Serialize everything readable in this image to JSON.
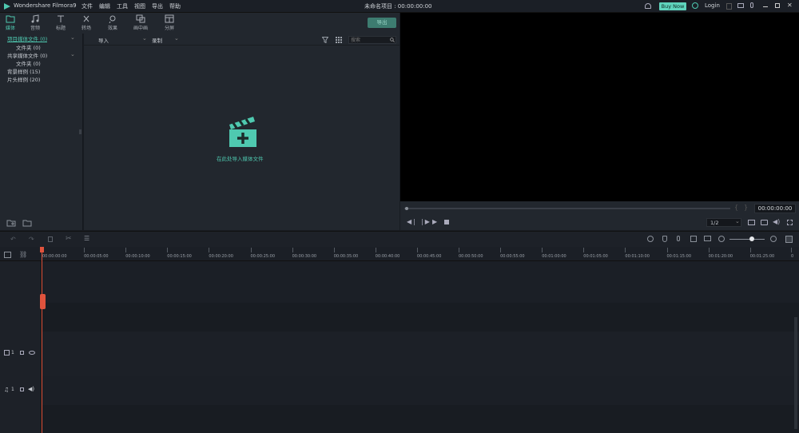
{
  "app": {
    "name": "Wondershare Filmora9"
  },
  "menu": [
    "文件",
    "编辑",
    "工具",
    "视图",
    "导出",
    "帮助"
  ],
  "title": "未命名项目 : 00:00:00:00",
  "topright": {
    "buy_now": "Buy Now",
    "login": "Login"
  },
  "toolbar": {
    "tabs": [
      "媒体",
      "音频",
      "标题",
      "转场",
      "效果",
      "画中画",
      "分屏"
    ],
    "export": "导出"
  },
  "sidebar": {
    "items": [
      "项目媒体文件 (0)",
      "文件夹 (0)",
      "共享媒体文件 (0)",
      "文件夹 (0)",
      "背景样例 (15)",
      "片头样例 (20)"
    ]
  },
  "media": {
    "import": "导入",
    "record": "录制",
    "search_placeholder": "搜索",
    "hint": "在此处导入媒体文件"
  },
  "preview": {
    "timecode": "00:00:00:00",
    "ratio": "1/2"
  },
  "ruler": [
    "00:00:00:00",
    "00:00:05:00",
    "00:00:10:00",
    "00:00:15:00",
    "00:00:20:00",
    "00:00:25:00",
    "00:00:30:00",
    "00:00:35:00",
    "00:00:40:00",
    "00:00:45:00",
    "00:00:50:00",
    "00:00:55:00",
    "00:01:00:00",
    "00:01:05:00",
    "00:01:10:00",
    "00:01:15:00",
    "00:01:20:00",
    "00:01:25:00",
    "0"
  ],
  "tracks": {
    "video_label": "1",
    "audio_label": "1"
  },
  "colors": {
    "accent": "#4fc9b0",
    "playhead": "#e0533d",
    "buy": "#5fd3bc"
  }
}
